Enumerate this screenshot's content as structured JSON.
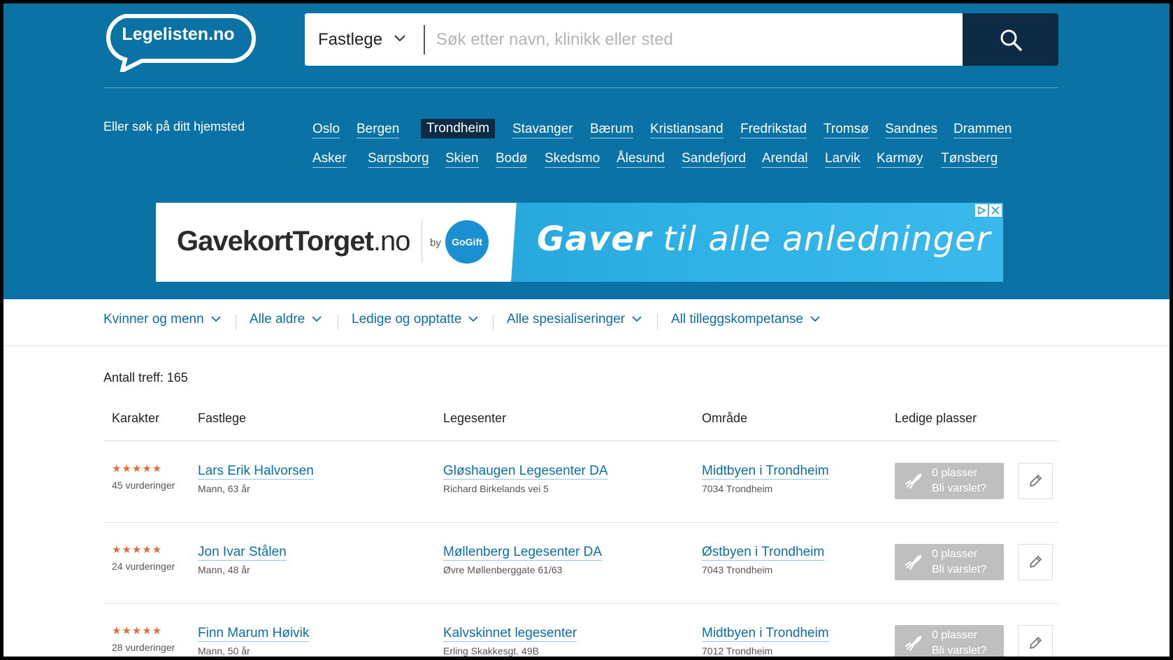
{
  "header": {
    "logo_text": "Legelisten.no",
    "search": {
      "type_selected": "Fastlege",
      "placeholder": "Søk etter navn, klinikk eller sted"
    },
    "hometown_label": "Eller søk på ditt hjemsted",
    "cities_row1": [
      "Oslo",
      "Bergen",
      "Trondheim",
      "Stavanger",
      "Bærum",
      "Kristiansand",
      "Fredrikstad",
      "Tromsø",
      "Sandnes",
      "Drammen"
    ],
    "cities_row2": [
      "Asker",
      "Sarpsborg",
      "Skien",
      "Bodø",
      "Skedsmo",
      "Ålesund",
      "Sandefjord",
      "Arendal",
      "Larvik",
      "Karmøy",
      "Tønsberg"
    ],
    "active_city": "Trondheim"
  },
  "ad": {
    "brand": "GavekortTorget",
    "brand_tld": ".no",
    "by": "by",
    "badge": "GoGift",
    "slogan_bold": "Gaver",
    "slogan_rest": " til alle anledninger"
  },
  "filters": [
    "Kvinner og menn",
    "Alle aldre",
    "Ledige og opptatte",
    "Alle spesialiseringer",
    "All tilleggskompetanse"
  ],
  "results": {
    "count_label": "Antall treff: 165",
    "columns": [
      "Karakter",
      "Fastlege",
      "Legesenter",
      "Område",
      "Ledige plasser"
    ],
    "rows": [
      {
        "stars": "★★★★★",
        "rating": 5,
        "reviews": "45 vurderinger",
        "doctor": "Lars Erik Halvorsen",
        "doctor_meta": "Mann, 63 år",
        "center": "Gløshaugen Legesenter DA",
        "address": "Richard Birkelands vei 5",
        "area": "Midtbyen i Trondheim",
        "postal": "7034 Trondheim",
        "slots": "0 plasser",
        "notify": "Bli varslet?"
      },
      {
        "stars": "★★★★★",
        "rating": 5,
        "reviews": "24 vurderinger",
        "doctor": "Jon Ivar Stålen",
        "doctor_meta": "Mann, 48 år",
        "center": "Møllenberg Legesenter DA",
        "address": "Øvre Møllenberggate 61/63",
        "area": "Østbyen i Trondheim",
        "postal": "7043 Trondheim",
        "slots": "0 plasser",
        "notify": "Bli varslet?"
      },
      {
        "stars": "★★★★★",
        "rating": 5,
        "reviews": "28 vurderinger",
        "doctor": "Finn Marum Høivik",
        "doctor_meta": "Mann, 50 år",
        "center": "Kalvskinnet legesenter",
        "address": "Erling Skakkesgt. 49B",
        "area": "Midtbyen i Trondheim",
        "postal": "7012 Trondheim",
        "slots": "0 plasser",
        "notify": "Bli varslet?"
      }
    ]
  },
  "colors": {
    "header_blue": "#0a72a5",
    "navy": "#0d2b44",
    "link": "#0b6fa3",
    "star": "#e06d3c",
    "disabled_button": "#bfbfbf"
  }
}
